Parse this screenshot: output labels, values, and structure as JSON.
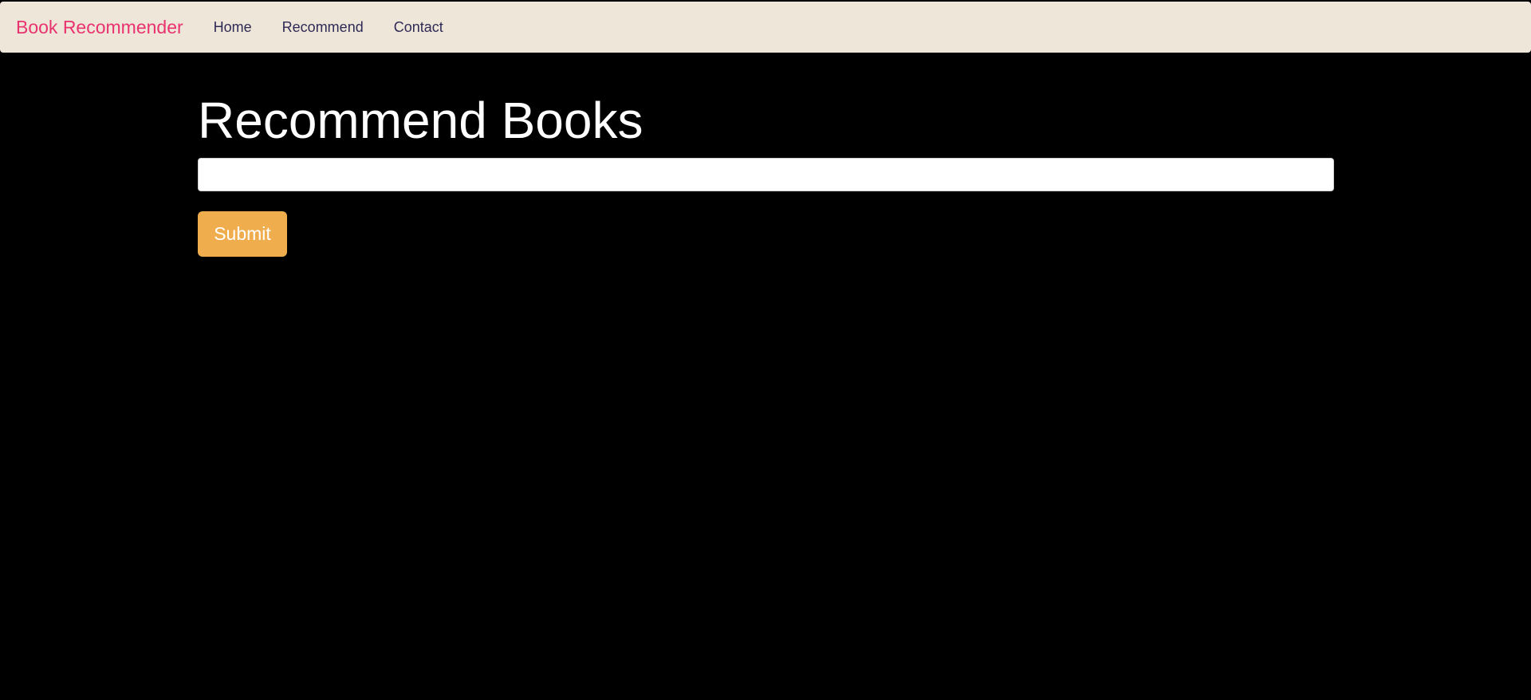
{
  "navbar": {
    "brand": "Book Recommender",
    "links": [
      {
        "label": "Home"
      },
      {
        "label": "Recommend"
      },
      {
        "label": "Contact"
      }
    ]
  },
  "main": {
    "title": "Recommend Books",
    "input": {
      "value": "",
      "placeholder": ""
    },
    "submit_label": "Submit"
  },
  "colors": {
    "navbar_bg": "#efe6da",
    "brand": "#e8336f",
    "nav_link": "#2f2a55",
    "page_bg": "#000000",
    "button_bg": "#f0ad4e"
  }
}
